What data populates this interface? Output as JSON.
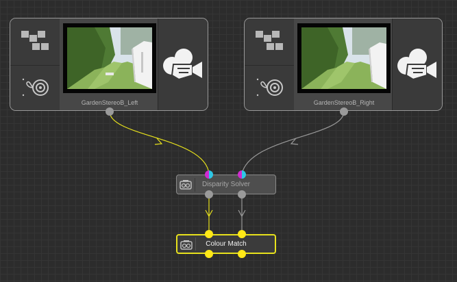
{
  "nodes": {
    "left_source": {
      "label": "GardenStereoB_Left"
    },
    "right_source": {
      "label": "GardenStereoB_Right"
    },
    "disparity_solver": {
      "label": "Disparity Solver"
    },
    "colour_match": {
      "label": "Colour Match"
    }
  },
  "colors": {
    "active_wire": "#e8e21c",
    "inactive_wire": "#9a9a9a",
    "port_cyan": "#2ec7e6",
    "port_magenta": "#d02ad0",
    "background": "#2c2c2c"
  },
  "icons": [
    "layers-icon",
    "lens-toggle-icon",
    "movie-camera-icon",
    "node-type-icon"
  ]
}
